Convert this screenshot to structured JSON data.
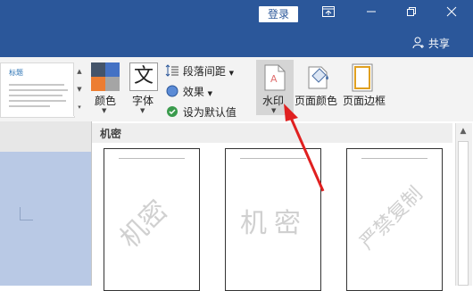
{
  "titlebar": {
    "login_label": "登录"
  },
  "sharebar": {
    "share_label": "共享"
  },
  "gallery": {
    "style_name": "标题"
  },
  "ribbon": {
    "colors_label": "颜色",
    "fonts_label": "字体",
    "fonts_glyph": "文",
    "paragraph_spacing_label": "段落间距",
    "effects_label": "效果",
    "set_default_label": "设为默认值",
    "watermark_label": "水印",
    "page_color_label": "页面颜色",
    "page_borders_label": "页面边框"
  },
  "watermark_panel": {
    "section_title": "机密",
    "items": [
      {
        "text": "机密",
        "orientation": "diagonal"
      },
      {
        "text": "机密",
        "orientation": "horizontal"
      },
      {
        "text": "严禁复制",
        "orientation": "diagonal"
      }
    ]
  },
  "colors": {
    "titlebar": "#2b579a",
    "ribbon": "#f3f3f3",
    "arrow": "#e02020",
    "highlight": "#d5d5d5"
  }
}
